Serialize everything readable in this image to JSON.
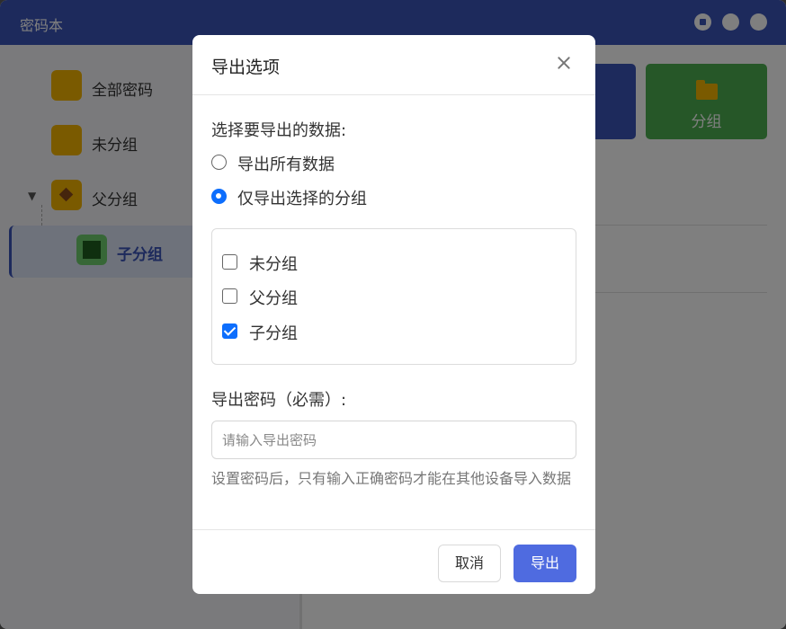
{
  "app": {
    "title": "密码本",
    "colors": {
      "accent": "#3b54b8",
      "green_tile": "#4caf50",
      "folder": "#f5b400"
    }
  },
  "sidebar": {
    "items": [
      {
        "label": "全部密码"
      },
      {
        "label": "未分组"
      },
      {
        "label": "父分组"
      },
      {
        "label": "子分组"
      }
    ]
  },
  "toolbar": {
    "group_tile_label": "分组"
  },
  "dialog": {
    "title": "导出选项",
    "select_label": "选择要导出的数据:",
    "options": [
      {
        "label": "导出所有数据",
        "checked": false
      },
      {
        "label": "仅导出选择的分组",
        "checked": true
      }
    ],
    "groups": [
      {
        "label": "未分组",
        "checked": false
      },
      {
        "label": "父分组",
        "checked": false
      },
      {
        "label": "子分组",
        "checked": true
      }
    ],
    "password_label": "导出密码（必需）:",
    "password_placeholder": "请输入导出密码",
    "password_value": "",
    "hint": "设置密码后，只有输入正确密码才能在其他设备导入数据",
    "cancel_label": "取消",
    "export_label": "导出"
  }
}
